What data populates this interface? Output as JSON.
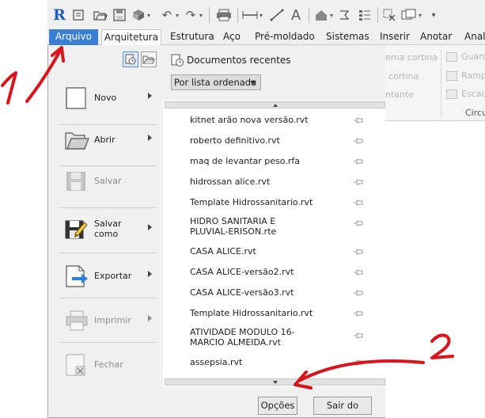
{
  "quick_access": {
    "logo": "R",
    "icons": [
      "revit-logo-icon",
      "open-icon",
      "folder-open-icon",
      "save-icon",
      "sync-icon",
      "undo-icon",
      "undo-dropdown-icon",
      "redo-icon",
      "redo-dropdown-icon",
      "print-icon",
      "measure-icon",
      "dimension-icon",
      "text-icon",
      "model-icon",
      "model-dropdown-icon",
      "tags-icon",
      "close-hidden-icon",
      "switch-windows-icon",
      "switch-dropdown-icon"
    ]
  },
  "ribbon_tabs": [
    "Arquivo",
    "Arquitetura",
    "Estrutura",
    "Aço",
    "Pré-moldado",
    "Sistemas",
    "Inserir",
    "Anotar",
    "Anali"
  ],
  "ribbon_bg": {
    "items": [
      "ema cortina",
      "Guard",
      "cortina",
      "Ramp",
      "ntante",
      "Escad",
      "Circu"
    ]
  },
  "app_menu": {
    "items": [
      {
        "label": "Novo",
        "enabled": true,
        "icon": "new-document-icon"
      },
      {
        "label": "Abrir",
        "enabled": true,
        "icon": "folder-open-icon"
      },
      {
        "label": "Salvar",
        "enabled": false,
        "icon": "floppy-disk-icon"
      },
      {
        "label": "Salvar como",
        "enabled": true,
        "icon": "save-as-icon"
      },
      {
        "label": "Exportar",
        "enabled": true,
        "icon": "export-icon"
      },
      {
        "label": "Imprimir",
        "enabled": false,
        "icon": "printer-icon"
      },
      {
        "label": "Fechar",
        "enabled": false,
        "icon": "close-document-icon"
      }
    ],
    "recent": {
      "title": "Documentos recentes",
      "sort_value": "Por lista ordenada",
      "documents": [
        "kitnet arão nova versão.rvt",
        "roberto definitivo.rvt",
        "maq de levantar peso.rfa",
        "hidrossan alice.rvt",
        "Template Hidrossanitario.rvt",
        "HIDRO SANITARIA E PLUVIAL-ERISON.rte",
        "CASA ALICE.rvt",
        "CASA ALICE-versão2.rvt",
        "CASA ALICE-versão3.rvt",
        "Template Hidrossanitario.rvt",
        "ATIVIDADE MODULO 16-MARCIO ALMEIDA.rvt",
        "assepsia.rvt"
      ]
    },
    "buttons": {
      "options": "Opções",
      "exit": "Sair do Revit"
    }
  },
  "annotations": {
    "number1": "1",
    "number2": "2",
    "color": "#d8151c"
  },
  "colors": {
    "accent": "#3a7fd6",
    "menu_bg": "#f0f0f0",
    "annotation": "#d8151c"
  }
}
